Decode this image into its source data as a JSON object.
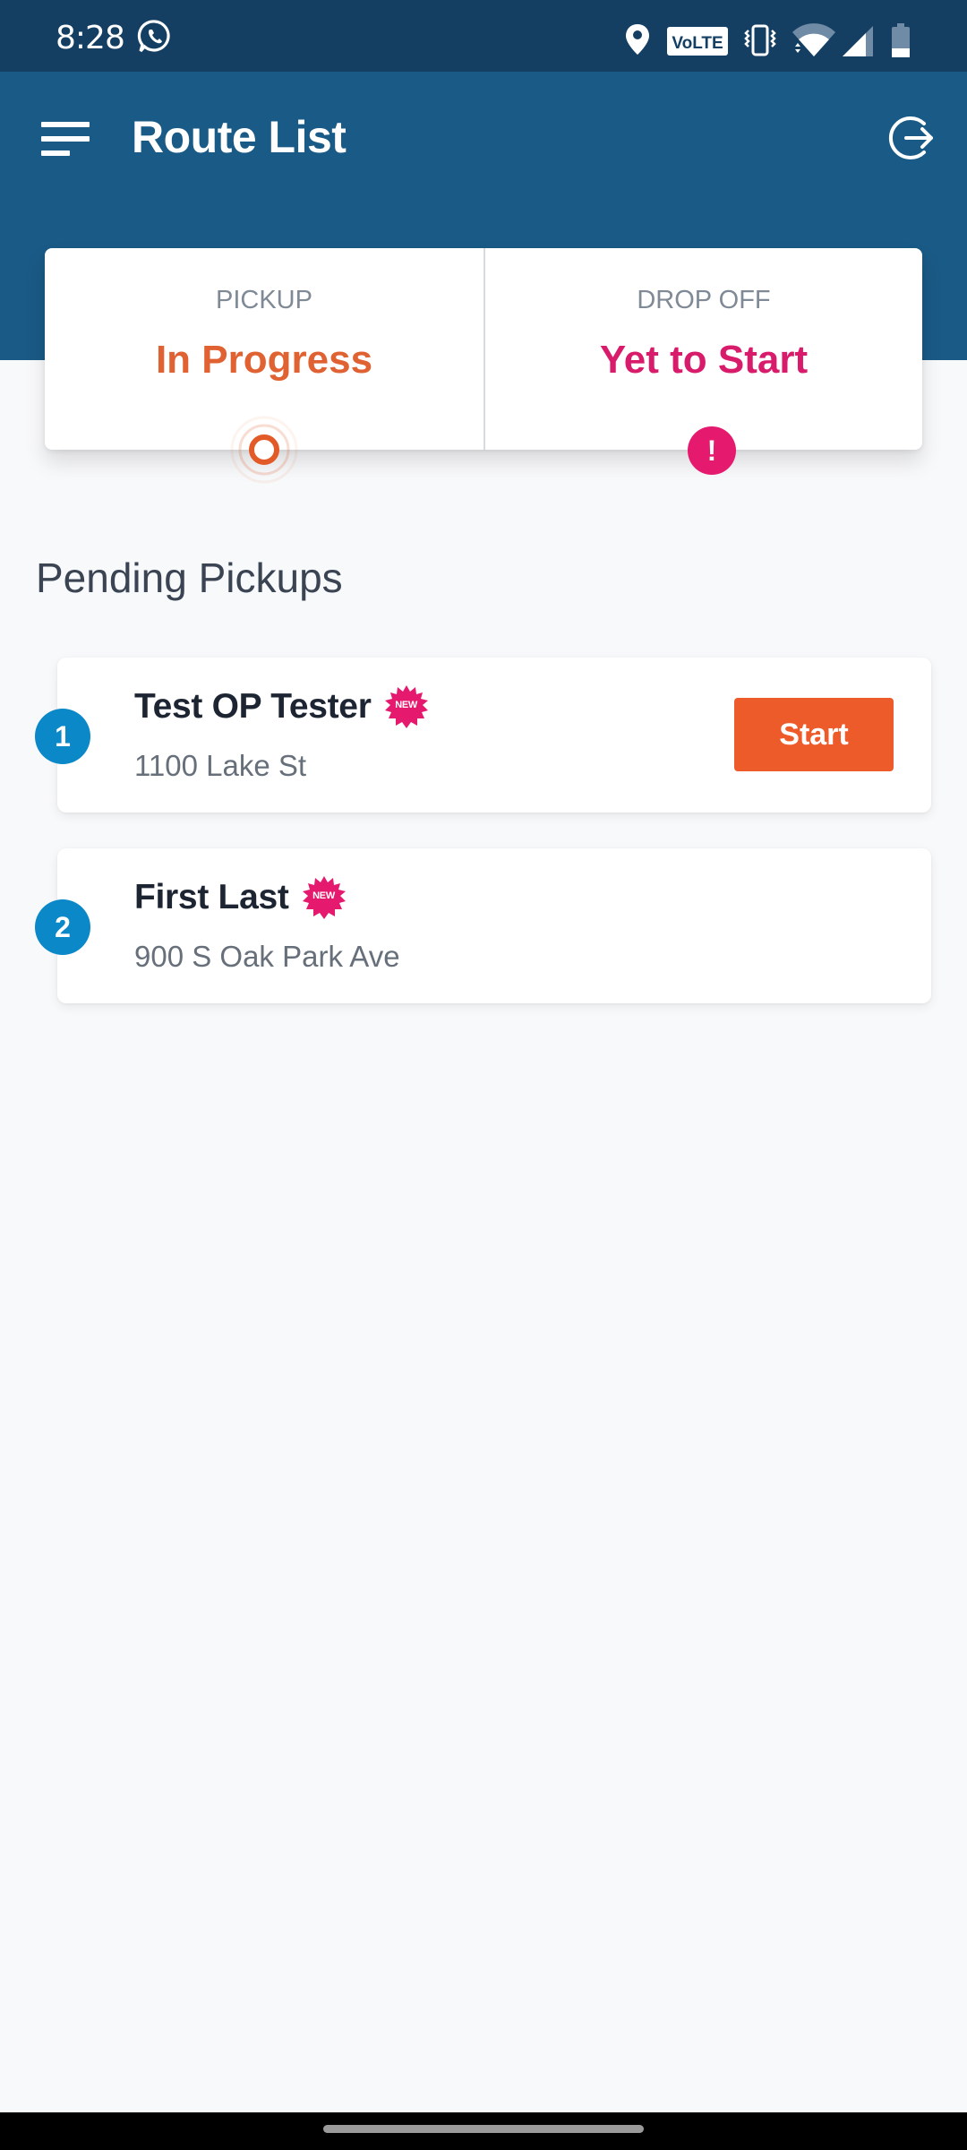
{
  "status_bar": {
    "time": "8:28",
    "left_icons": [
      "whatsapp-icon"
    ],
    "right_icons": [
      "location-icon",
      "volte-icon",
      "vibrate-icon",
      "wifi-icon",
      "signal-icon",
      "battery-icon"
    ],
    "volte_label": "VoLTE"
  },
  "app_bar": {
    "title": "Route List",
    "menu_icon": "hamburger-menu-icon",
    "action_icon": "logout-icon",
    "color": "#1a5a86"
  },
  "status_summary": {
    "pickup": {
      "label": "PICKUP",
      "value": "In Progress",
      "color": "#e06232",
      "indicator": "in-progress-ring-icon"
    },
    "dropoff": {
      "label": "DROP OFF",
      "value": "Yet to Start",
      "color": "#d81b6a",
      "indicator": "alert-icon",
      "indicator_glyph": "!"
    }
  },
  "section": {
    "title": "Pending Pickups"
  },
  "pickups": [
    {
      "number": "1",
      "name": "Test OP Tester",
      "badge": "NEW",
      "address": "1100 Lake St",
      "action_label": "Start"
    },
    {
      "number": "2",
      "name": "First Last",
      "badge": "NEW",
      "address": "900 S Oak Park Ave"
    }
  ],
  "colors": {
    "status_bar": "#143f63",
    "accent_orange": "#ee5b2a",
    "badge_pink": "#e5196e",
    "number_blue": "#0b88c8",
    "background": "#f8f9fb"
  }
}
